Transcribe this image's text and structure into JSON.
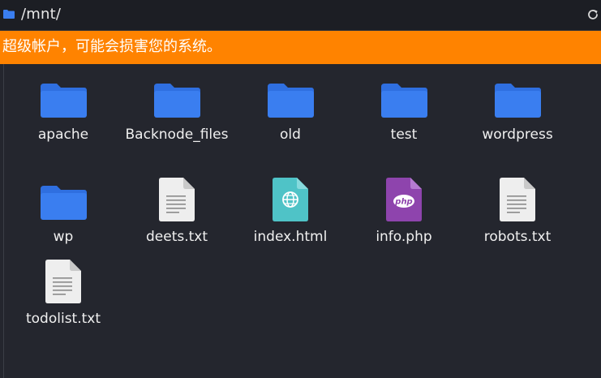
{
  "pathbar": {
    "path": "/mnt/"
  },
  "warning": {
    "text": "超级帐户，可能会损害您的系统。"
  },
  "colors": {
    "folder": "#3a7ef0",
    "folder_tab": "#2f6fe0",
    "warning_bg": "#ff8300",
    "html_file": "#4fc3c7",
    "php_file": "#8e44ad",
    "text_file": "#eeeeee"
  },
  "items": [
    {
      "label": "apache",
      "icon": "folder-icon"
    },
    {
      "label": "Backnode_files",
      "icon": "folder-icon"
    },
    {
      "label": "old",
      "icon": "folder-icon"
    },
    {
      "label": "test",
      "icon": "folder-icon"
    },
    {
      "label": "wordpress",
      "icon": "folder-icon"
    },
    {
      "label": "wp",
      "icon": "folder-icon"
    },
    {
      "label": "deets.txt",
      "icon": "text-file-icon"
    },
    {
      "label": "index.html",
      "icon": "html-file-icon"
    },
    {
      "label": "info.php",
      "icon": "php-file-icon",
      "badge": "php"
    },
    {
      "label": "robots.txt",
      "icon": "text-file-icon"
    },
    {
      "label": "todolist.txt",
      "icon": "text-file-icon"
    }
  ]
}
